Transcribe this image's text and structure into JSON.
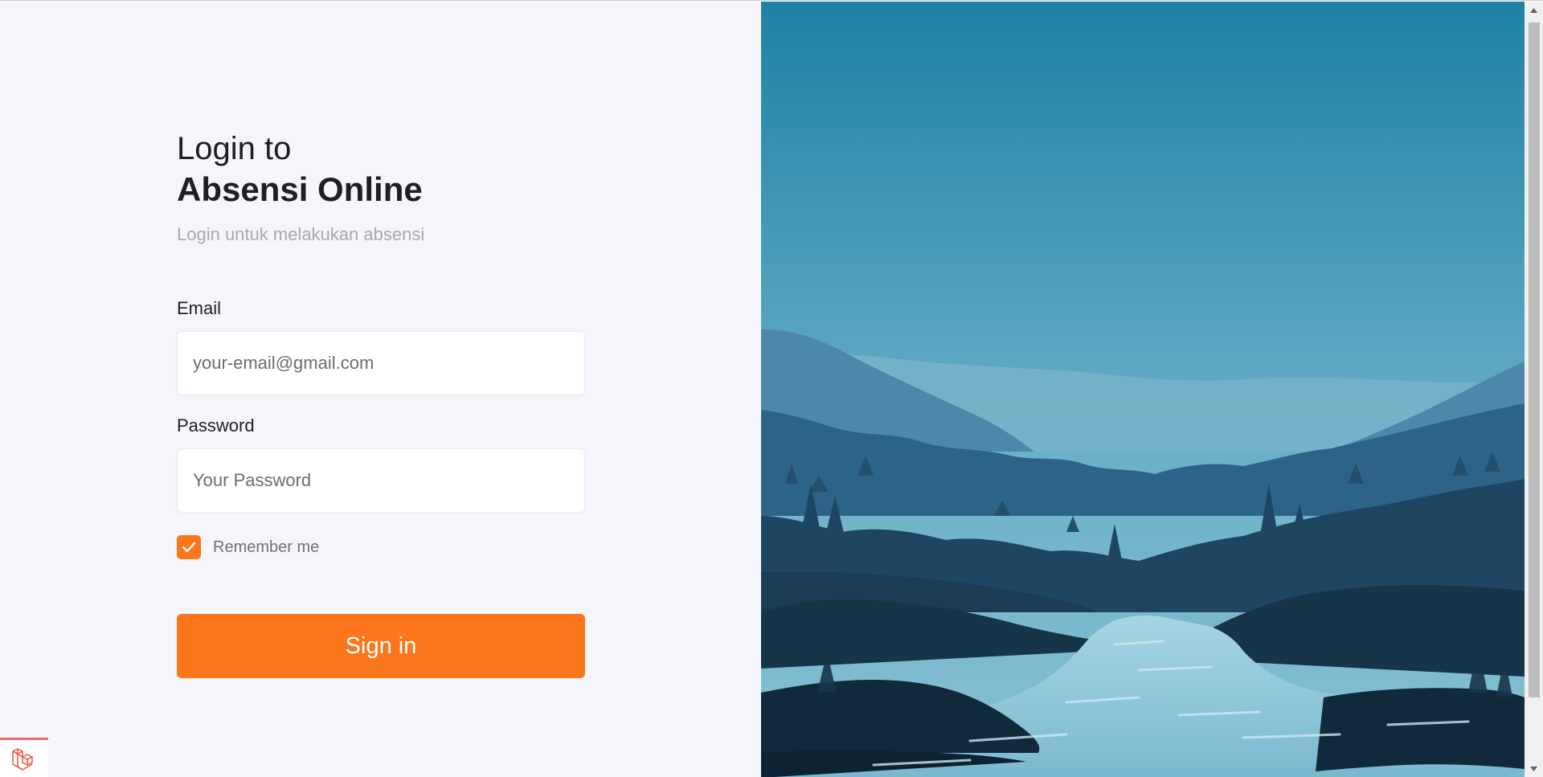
{
  "login": {
    "title_line1": "Login to",
    "title_line2": "Absensi Online",
    "subtitle": "Login untuk melakukan absensi",
    "email_label": "Email",
    "email_placeholder": "your-email@gmail.com",
    "password_label": "Password",
    "password_placeholder": "Your Password",
    "remember_label": "Remember me",
    "remember_checked": true,
    "signin_label": "Sign in"
  },
  "colors": {
    "accent": "#fc761c",
    "left_background": "#f5f6fb",
    "sky_top": "#1e82a5",
    "sky_bottom": "#86c0d3"
  },
  "icons": {
    "checkbox": "checkmark-icon",
    "badge": "laravel-logo-icon",
    "scroll_up": "scroll-up-arrow-icon",
    "scroll_down": "scroll-down-arrow-icon"
  }
}
